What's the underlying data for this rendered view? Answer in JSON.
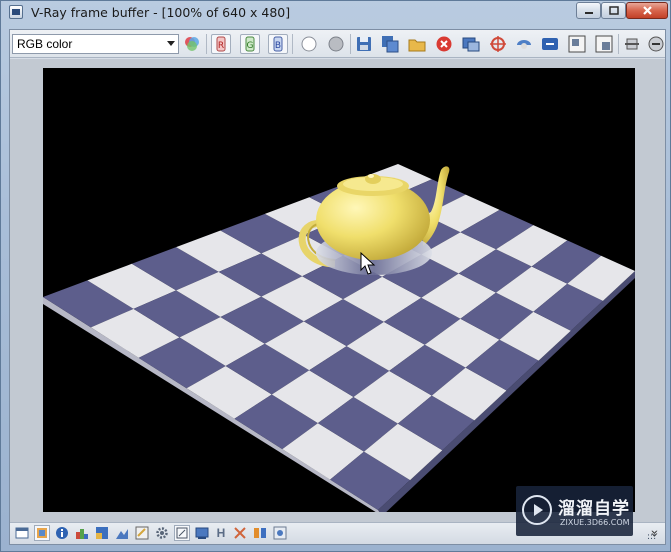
{
  "window": {
    "title": "V-Ray frame buffer - [100% of 640 x 480]"
  },
  "toolbar": {
    "channel_value": "RGB color",
    "buttons": [
      {
        "name": "color-wheel-icon"
      },
      {
        "name": "red-channel-icon",
        "label": "R"
      },
      {
        "name": "green-channel-icon",
        "label": "G"
      },
      {
        "name": "blue-channel-icon",
        "label": "B"
      },
      {
        "name": "alpha-white-circle-icon"
      },
      {
        "name": "mono-gray-circle-icon"
      },
      {
        "name": "save-image-icon"
      },
      {
        "name": "save-all-icon"
      },
      {
        "name": "open-image-icon"
      },
      {
        "name": "clear-image-icon"
      },
      {
        "name": "duplicate-to-max-fb-icon"
      },
      {
        "name": "track-mouse-icon"
      },
      {
        "name": "render-region-icon"
      },
      {
        "name": "link-to-vfb-icon"
      },
      {
        "name": "region-render-icon"
      },
      {
        "name": "render-last-icon"
      },
      {
        "name": "stop-render-icon"
      },
      {
        "name": "expand-icon"
      }
    ]
  },
  "render": {
    "floor_color_dark": "#5d5e8c",
    "floor_color_light": "#e6e6ea",
    "teapot_color": "#f0df6c",
    "background": "#000000"
  },
  "statusbar": {
    "h_label": "H",
    "expand_label": "»"
  },
  "watermark": {
    "title": "溜溜自学",
    "url": "ZIXUE.3D66.COM"
  }
}
